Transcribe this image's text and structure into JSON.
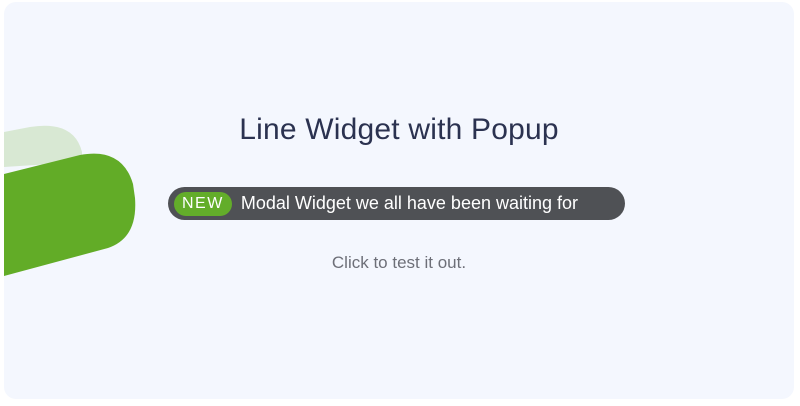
{
  "title": "Line Widget with Popup",
  "announcement": {
    "badge": "NEW",
    "text": "Modal Widget we all have been waiting for"
  },
  "subtitle": "Click to test it out.",
  "colors": {
    "background": "#f4f7fe",
    "title": "#2b3250",
    "pill": "#4f5155",
    "badge": "#63ad2a",
    "subtitle": "#6d6f78",
    "decor_green": "#62ac27",
    "decor_light_green": "#d8e8d3"
  }
}
